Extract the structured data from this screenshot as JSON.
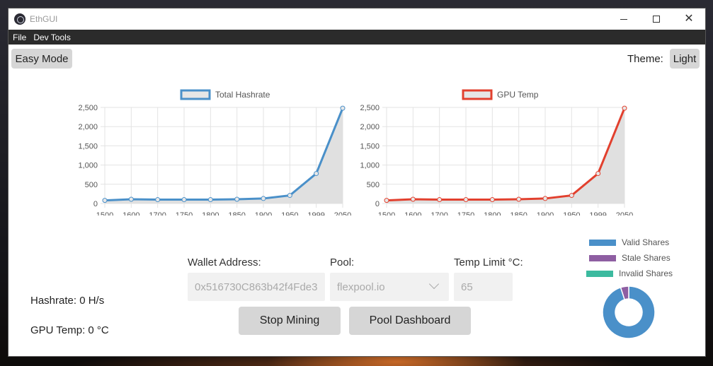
{
  "window": {
    "title": "EthGUI",
    "controls": {
      "minimize": "minimize",
      "maximize": "maximize",
      "close": "close"
    }
  },
  "menu": {
    "items": [
      "File",
      "Dev Tools"
    ]
  },
  "toolbar": {
    "easy_mode_label": "Easy Mode",
    "theme_label": "Theme:",
    "theme_value": "Light"
  },
  "chart_data": [
    {
      "type": "line",
      "series": [
        {
          "name": "Total Hashrate",
          "color": "#4a90c9",
          "values": [
            80,
            110,
            100,
            100,
            100,
            110,
            130,
            210,
            780,
            2480
          ]
        }
      ],
      "x": [
        "1500",
        "1600",
        "1700",
        "1750",
        "1800",
        "1850",
        "1900",
        "1950",
        "1999",
        "2050"
      ],
      "yticks": [
        "0",
        "500",
        "1,000",
        "1,500",
        "2,000",
        "2,500"
      ],
      "ylim": [
        0,
        2500
      ],
      "grid": true,
      "legend": "top",
      "fill": "#e0e0e0"
    },
    {
      "type": "line",
      "series": [
        {
          "name": "GPU Temp",
          "color": "#e2402e",
          "values": [
            80,
            110,
            100,
            100,
            100,
            110,
            130,
            210,
            780,
            2480
          ]
        }
      ],
      "x": [
        "1500",
        "1600",
        "1700",
        "1750",
        "1800",
        "1850",
        "1900",
        "1950",
        "1999",
        "2050"
      ],
      "yticks": [
        "0",
        "500",
        "1,000",
        "1,500",
        "2,000",
        "2,500"
      ],
      "ylim": [
        0,
        2500
      ],
      "grid": true,
      "legend": "top",
      "fill": "#e0e0e0"
    }
  ],
  "form": {
    "wallet_label": "Wallet Address:",
    "wallet_value": "0x516730C863b42f4Fde3",
    "pool_label": "Pool:",
    "pool_value": "flexpool.io",
    "temp_label": "Temp Limit °C:",
    "temp_value": "65"
  },
  "actions": {
    "stop_label": "Stop Mining",
    "dashboard_label": "Pool Dashboard"
  },
  "stats": {
    "hashrate": "Hashrate: 0 H/s",
    "gpu_temp": "GPU Temp: 0 °C"
  },
  "shares": {
    "legend": [
      {
        "label": "Valid Shares",
        "color": "#4a90c9"
      },
      {
        "label": "Stale Shares",
        "color": "#8e5ea2"
      },
      {
        "label": "Invalid Shares",
        "color": "#3cba9f"
      }
    ],
    "fractions": {
      "valid": 0.95,
      "stale": 0.05,
      "invalid": 0.0
    }
  }
}
